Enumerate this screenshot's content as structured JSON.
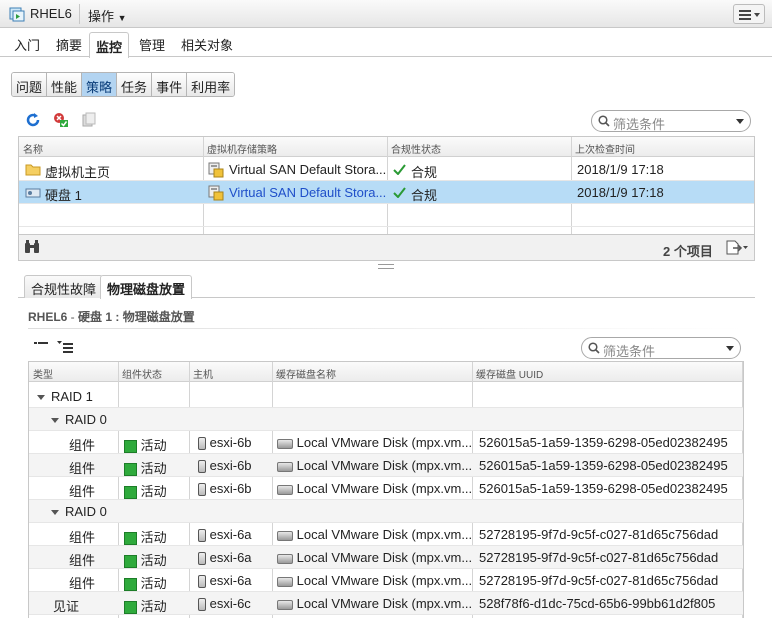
{
  "vm": {
    "name": "RHEL6",
    "actions_label": "操作"
  },
  "main_tabs": [
    {
      "label": "入门"
    },
    {
      "label": "摘要"
    },
    {
      "label": "监控"
    },
    {
      "label": "管理"
    },
    {
      "label": "相关对象"
    }
  ],
  "monitor_tabs": [
    {
      "label": "问题"
    },
    {
      "label": "性能"
    },
    {
      "label": "策略"
    },
    {
      "label": "任务"
    },
    {
      "label": "事件"
    },
    {
      "label": "利用率"
    }
  ],
  "filter_placeholder": "筛选条件",
  "policy_table": {
    "headers": [
      "名称",
      "虚拟机存储策略",
      "合规性状态",
      "上次检查时间"
    ],
    "rows": [
      {
        "name": "虚拟机主页",
        "policy": "Virtual SAN Default Stora...",
        "status": "合规",
        "time": "2018/1/9 17:18"
      },
      {
        "name": "硬盘 1",
        "policy": "Virtual SAN Default Stora...",
        "status": "合规",
        "time": "2018/1/9 17:18"
      }
    ],
    "count": "2 个项目"
  },
  "detail_tabs": [
    {
      "label": "合规性故障"
    },
    {
      "label": "物理磁盘放置"
    }
  ],
  "detail": {
    "vm": "RHEL6",
    "sep": " - ",
    "title": "硬盘 1 : 物理磁盘放置"
  },
  "placement_table": {
    "headers": [
      "类型",
      "组件状态",
      "主机",
      "缓存磁盘名称",
      "缓存磁盘 UUID"
    ],
    "rows": [
      {
        "type": "RAID 1",
        "state": "",
        "host": "",
        "disk": "",
        "uuid": ""
      },
      {
        "type": "RAID 0",
        "state": "",
        "host": "",
        "disk": "",
        "uuid": ""
      },
      {
        "type": "组件",
        "state": "活动",
        "host": "esxi-6b",
        "disk": "Local VMware Disk (mpx.vm...",
        "uuid": "526015a5-1a59-1359-6298-05ed02382495"
      },
      {
        "type": "组件",
        "state": "活动",
        "host": "esxi-6b",
        "disk": "Local VMware Disk (mpx.vm...",
        "uuid": "526015a5-1a59-1359-6298-05ed02382495"
      },
      {
        "type": "组件",
        "state": "活动",
        "host": "esxi-6b",
        "disk": "Local VMware Disk (mpx.vm...",
        "uuid": "526015a5-1a59-1359-6298-05ed02382495"
      },
      {
        "type": "RAID 0",
        "state": "",
        "host": "",
        "disk": "",
        "uuid": ""
      },
      {
        "type": "组件",
        "state": "活动",
        "host": "esxi-6a",
        "disk": "Local VMware Disk (mpx.vm...",
        "uuid": "52728195-9f7d-9c5f-c027-81d65c756dad"
      },
      {
        "type": "组件",
        "state": "活动",
        "host": "esxi-6a",
        "disk": "Local VMware Disk (mpx.vm...",
        "uuid": "52728195-9f7d-9c5f-c027-81d65c756dad"
      },
      {
        "type": "组件",
        "state": "活动",
        "host": "esxi-6a",
        "disk": "Local VMware Disk (mpx.vm...",
        "uuid": "52728195-9f7d-9c5f-c027-81d65c756dad"
      },
      {
        "type": "见证",
        "state": "活动",
        "host": "esxi-6c",
        "disk": "Local VMware Disk (mpx.vm...",
        "uuid": "528f78f6-d1dc-75cd-65b6-99bb61d2f805"
      }
    ]
  },
  "colors": {
    "accent": "#b3d4f1",
    "selected_row": "#b7dcf6",
    "ok_green": "#2faa3c",
    "link": "#1f4fc9"
  }
}
